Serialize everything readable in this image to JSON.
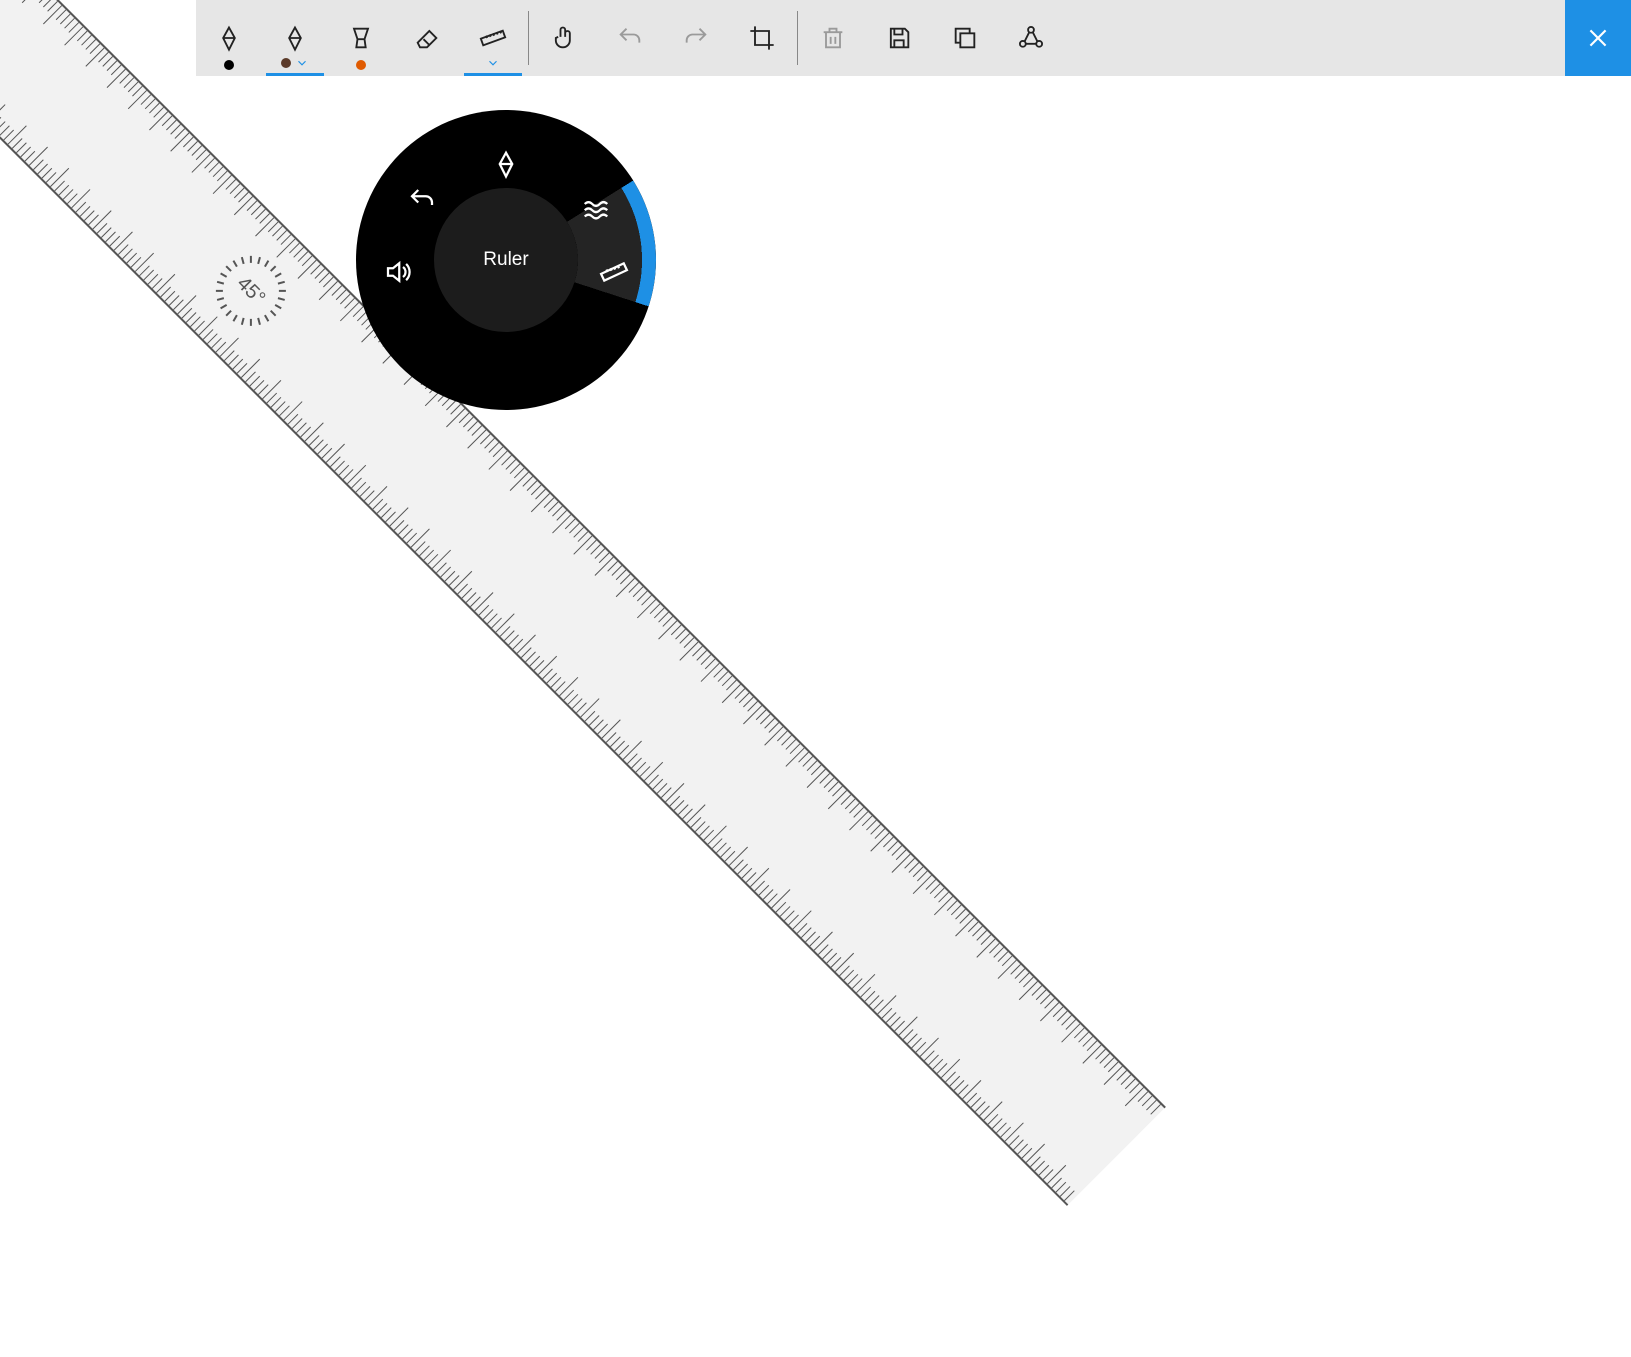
{
  "toolbar": {
    "pens": [
      {
        "name": "pen-1",
        "color": "#000000",
        "selected": false,
        "dropdown": false
      },
      {
        "name": "pen-2",
        "color": "#5b3a29",
        "selected": true,
        "dropdown": true
      },
      {
        "name": "highlighter",
        "color": "#e05a00",
        "selected": false,
        "dropdown": false
      }
    ],
    "tools": {
      "eraser": "Eraser",
      "ruler": "Ruler",
      "touch": "Touch writing",
      "undo": "Undo",
      "redo": "Redo",
      "crop": "Crop",
      "delete": "Delete",
      "save": "Save",
      "copy": "Copy",
      "share": "Share",
      "close": "Close"
    },
    "ruler_selected": true,
    "undo_enabled": false,
    "redo_enabled": false,
    "delete_enabled": false
  },
  "ruler": {
    "angle_label": "45°",
    "angle_value": 45
  },
  "radial": {
    "center_label": "Ruler",
    "items": {
      "pen": "Pen",
      "waves": "Stroke size",
      "ruler": "Ruler",
      "volume": "Volume",
      "undo": "Undo"
    },
    "selected": "ruler"
  },
  "colors": {
    "accent": "#1e90e5"
  }
}
